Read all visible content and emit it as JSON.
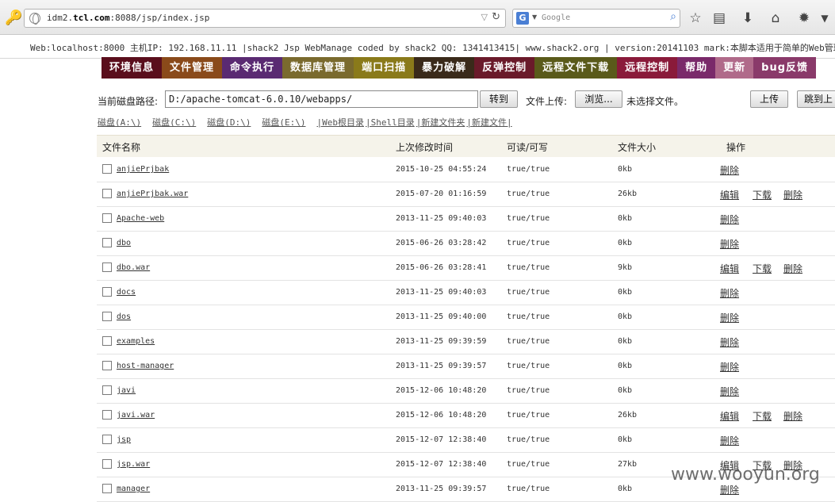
{
  "browser": {
    "url_prefix": "idm2.",
    "url_host": "tcl.com",
    "url_suffix": ":8088/jsp/index.jsp",
    "search_placeholder": "Google",
    "search_engine_letter": "G"
  },
  "info_bar": "Web:localhost:8000 主机IP: 192.168.11.11 |shack2 Jsp WebManage coded by shack2 QQ: 1341413415| www.shack2.org | version:20141103 mark:本脚本适用于简单的Web管理，为了兼容",
  "nav": {
    "tabs": [
      {
        "label": "环境信息",
        "color": "#5a0e1c"
      },
      {
        "label": "文件管理",
        "color": "#8a4a1a"
      },
      {
        "label": "命令执行",
        "color": "#5a2a72"
      },
      {
        "label": "数据库管理",
        "color": "#7a6a2e"
      },
      {
        "label": "端口扫描",
        "color": "#8a7a1a"
      },
      {
        "label": "暴力破解",
        "color": "#3a2a1a"
      },
      {
        "label": "反弹控制",
        "color": "#6a1a2a"
      },
      {
        "label": "远程文件下载",
        "color": "#5a5a1a"
      },
      {
        "label": "远程控制",
        "color": "#8a1a3a"
      },
      {
        "label": "帮助",
        "color": "#7a2a6a"
      },
      {
        "label": "更新",
        "color": "#b06a8a"
      },
      {
        "label": "bug反馈",
        "color": "#8a3a6a"
      }
    ]
  },
  "path": {
    "label": "当前磁盘路径:",
    "value": "D:/apache-tomcat-6.0.10/webapps/",
    "go_button": "转到",
    "upload_label": "文件上传:",
    "browse_button": "浏览...",
    "no_file": "未选择文件。",
    "upload_button": "上传",
    "jump_button": "跳到上"
  },
  "drives": {
    "a": "磁盘(A:\\)",
    "c": "磁盘(C:\\)",
    "d": "磁盘(D:\\)",
    "e": "磁盘(E:\\)",
    "web_root": "|Web根目录",
    "shell_dir": "|Shell目录",
    "new_folder": "|新建文件夹",
    "new_file": "|新建文件|"
  },
  "table": {
    "headers": {
      "name": "文件名称",
      "modified": "上次修改时间",
      "rw": "可读/可写",
      "size": "文件大小",
      "ops": "操作"
    },
    "op_labels": {
      "edit": "编辑",
      "download": "下载",
      "delete": "删除"
    },
    "rows": [
      {
        "name": "anjiePrjbak",
        "modified": "2015-10-25 04:55:24",
        "rw": "true/true",
        "size": "0kb",
        "is_file": false
      },
      {
        "name": "anjiePrjbak.war",
        "modified": "2015-07-20 01:16:59",
        "rw": "true/true",
        "size": "26kb",
        "is_file": true
      },
      {
        "name": "Apache-web",
        "modified": "2013-11-25 09:40:03",
        "rw": "true/true",
        "size": "0kb",
        "is_file": false
      },
      {
        "name": "dbo",
        "modified": "2015-06-26 03:28:42",
        "rw": "true/true",
        "size": "0kb",
        "is_file": false
      },
      {
        "name": "dbo.war",
        "modified": "2015-06-26 03:28:41",
        "rw": "true/true",
        "size": "9kb",
        "is_file": true
      },
      {
        "name": "docs",
        "modified": "2013-11-25 09:40:03",
        "rw": "true/true",
        "size": "0kb",
        "is_file": false
      },
      {
        "name": "dos",
        "modified": "2013-11-25 09:40:00",
        "rw": "true/true",
        "size": "0kb",
        "is_file": false
      },
      {
        "name": "examples",
        "modified": "2013-11-25 09:39:59",
        "rw": "true/true",
        "size": "0kb",
        "is_file": false
      },
      {
        "name": "host-manager",
        "modified": "2013-11-25 09:39:57",
        "rw": "true/true",
        "size": "0kb",
        "is_file": false
      },
      {
        "name": "javi",
        "modified": "2015-12-06 10:48:20",
        "rw": "true/true",
        "size": "0kb",
        "is_file": false
      },
      {
        "name": "javi.war",
        "modified": "2015-12-06 10:48:20",
        "rw": "true/true",
        "size": "26kb",
        "is_file": true
      },
      {
        "name": "jsp",
        "modified": "2015-12-07 12:38:40",
        "rw": "true/true",
        "size": "0kb",
        "is_file": false
      },
      {
        "name": "jsp.war",
        "modified": "2015-12-07 12:38:40",
        "rw": "true/true",
        "size": "27kb",
        "is_file": true
      },
      {
        "name": "manager",
        "modified": "2013-11-25 09:39:57",
        "rw": "true/true",
        "size": "0kb",
        "is_file": false
      }
    ]
  },
  "watermark": "www.wooyun.org"
}
